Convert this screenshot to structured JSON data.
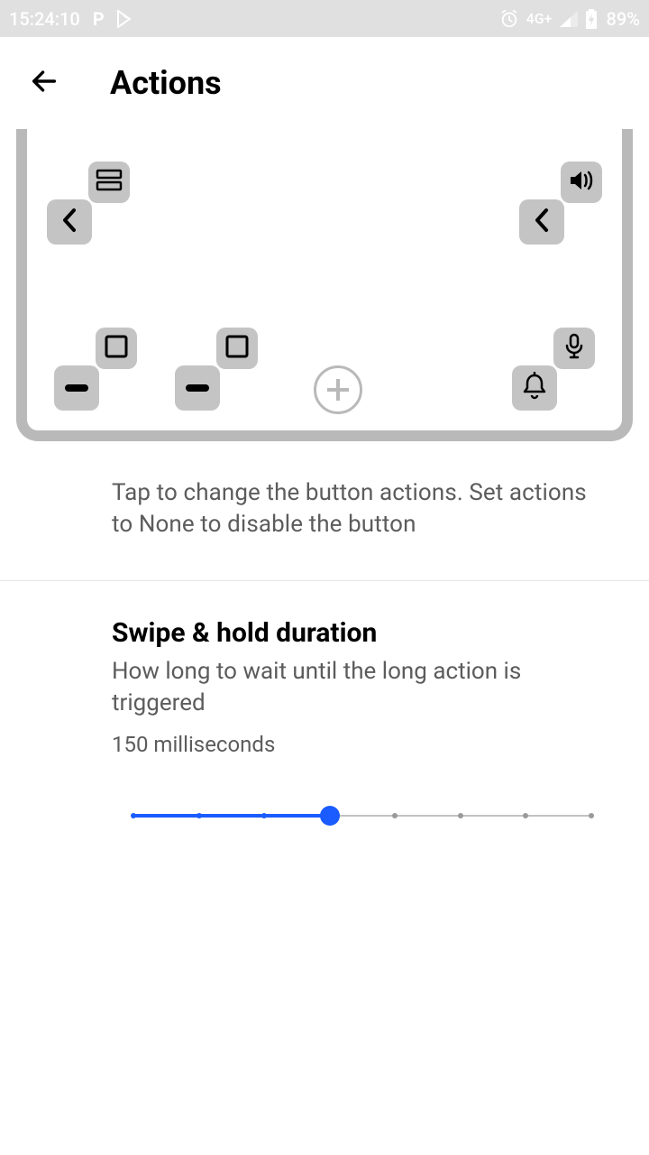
{
  "statusbar": {
    "time": "15:24:10",
    "network_label": "4G+",
    "battery_pct": "89%"
  },
  "header": {
    "title": "Actions"
  },
  "preview": {
    "buttons": {
      "top_left_primary": "chevron-left-icon",
      "top_left_secondary": "list-rows-icon",
      "top_right_primary": "chevron-left-icon",
      "top_right_secondary": "volume-icon",
      "bottom_1_primary": "dash-icon",
      "bottom_1_secondary": "square-outline-icon",
      "bottom_2_primary": "dash-icon",
      "bottom_2_secondary": "square-outline-icon",
      "bottom_3": "add-icon",
      "bottom_4_primary": "bell-icon",
      "bottom_4_secondary": "mic-icon"
    },
    "hint": "Tap to change the button actions. Set actions to None to disable the button"
  },
  "swipe_hold": {
    "title": "Swipe & hold duration",
    "desc": "How long to wait until the long action is triggered",
    "value_label": "150 milliseconds",
    "ticks": 8,
    "current_index": 3
  }
}
